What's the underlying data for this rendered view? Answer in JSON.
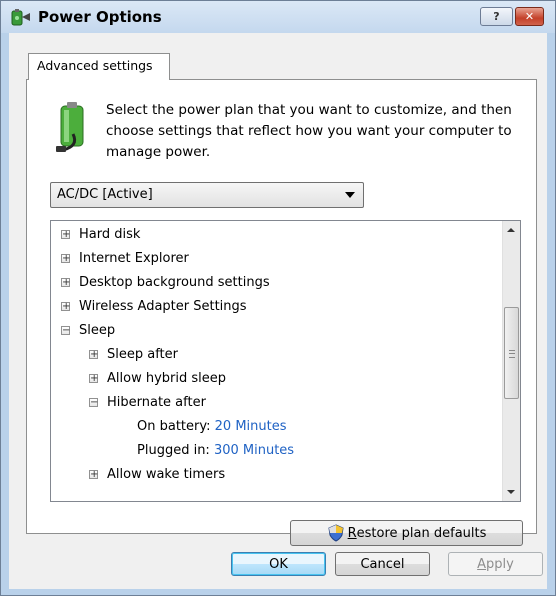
{
  "window": {
    "title": "Power Options",
    "help_label": "?",
    "close_label": "✕"
  },
  "tab": {
    "label": "Advanced settings"
  },
  "intro_text": "Select the power plan that you want to customize, and then choose settings that reflect how you want your computer to manage power.",
  "plan_select": {
    "value": "AC/DC [Active]"
  },
  "tree": {
    "items": [
      {
        "label": "Hard disk",
        "expander": "+"
      },
      {
        "label": "Internet Explorer",
        "expander": "+"
      },
      {
        "label": "Desktop background settings",
        "expander": "+"
      },
      {
        "label": "Wireless Adapter Settings",
        "expander": "+"
      },
      {
        "label": "Sleep",
        "expander": "−"
      },
      {
        "label": "Sleep after",
        "expander": "+"
      },
      {
        "label": "Allow hybrid sleep",
        "expander": "+"
      },
      {
        "label": "Hibernate after",
        "expander": "−"
      },
      {
        "label": "On battery:",
        "value": "20 Minutes"
      },
      {
        "label": "Plugged in:",
        "value": "300 Minutes"
      },
      {
        "label": "Allow wake timers",
        "expander": "+"
      }
    ]
  },
  "buttons": {
    "restore_prefix": "R",
    "restore_rest": "estore plan defaults",
    "ok": "OK",
    "cancel": "Cancel",
    "apply_prefix": "A",
    "apply_rest": "pply"
  },
  "colors": {
    "setting_value": "#1f62c4",
    "frame": "#b9d1ea"
  }
}
